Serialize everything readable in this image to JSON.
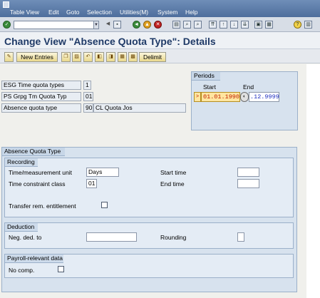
{
  "menu": {
    "items": [
      "Table View",
      "Edit",
      "Goto",
      "Selection",
      "Utilities(M)",
      "System",
      "Help"
    ]
  },
  "toolbar": {
    "command_field": "",
    "icons": [
      "enter-icon",
      "save-icon",
      "back-icon",
      "exit-icon",
      "cancel-icon",
      "print-icon",
      "find-icon",
      "find-next-icon",
      "first-page-icon",
      "previous-page-icon",
      "next-page-icon",
      "last-page-icon",
      "create-session-icon",
      "shortcut-icon",
      "help-icon",
      "customize-layout-icon"
    ]
  },
  "title": "Change View \"Absence Quota Type\": Details",
  "app_toolbar": {
    "new_entries": "New Entries",
    "delimit": "Delimit",
    "icons": [
      "display-change-icon",
      "copy-icon",
      "delete-icon",
      "undo-icon",
      "previous-entry-icon",
      "next-entry-icon",
      "select-all-icon"
    ]
  },
  "keys": [
    {
      "label": "ESG Time quota types",
      "value": "1"
    },
    {
      "label": "PS Grpg Tm Quota Typ",
      "value": "01"
    },
    {
      "label": "Absence quota type",
      "value": "90",
      "text": "CL Quota Jos"
    }
  ],
  "periods": {
    "title": "Periods",
    "start_label": "Start",
    "end_label": "End",
    "start": "01.01.1990",
    "end": ".12.9999",
    "marker": ">"
  },
  "absence_quota_type": {
    "title": "Absence Quota Type",
    "recording": {
      "title": "Recording",
      "time_unit_label": "Time/measurement unit",
      "time_unit_value": "Days",
      "constraint_label": "Time constraint class",
      "constraint_value": "01",
      "start_time_label": "Start time",
      "start_time_value": "",
      "end_time_label": "End time",
      "end_time_value": "",
      "transfer_label": "Transfer rem. entitlement",
      "transfer_checked": false
    },
    "deduction": {
      "title": "Deduction",
      "neg_ded_label": "Neg. ded. to",
      "neg_ded_value": "",
      "rounding_label": "Rounding",
      "rounding_value": ""
    },
    "payroll": {
      "title": "Payroll-relevant data",
      "no_comp_label": "No comp.",
      "no_comp_checked": false
    }
  }
}
